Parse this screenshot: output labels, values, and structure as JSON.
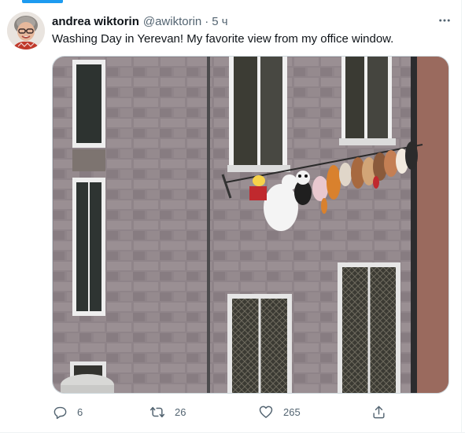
{
  "tweet": {
    "author": {
      "display_name": "andrea wiktorin",
      "handle": "@awiktorin"
    },
    "separator": "·",
    "time": "5 ч",
    "text": "Washing Day in Yerevan! My favorite view from my office window.",
    "stats": {
      "replies": "6",
      "retweets": "26",
      "likes": "265"
    }
  },
  "colors": {
    "accent": "#1d9bf0",
    "text_primary": "#0f1419",
    "text_secondary": "#536471",
    "border": "#cfd9de"
  },
  "icons": {
    "more": "more-horizontal-icon",
    "reply": "reply-icon",
    "retweet": "retweet-icon",
    "like": "heart-icon",
    "share": "share-icon"
  }
}
